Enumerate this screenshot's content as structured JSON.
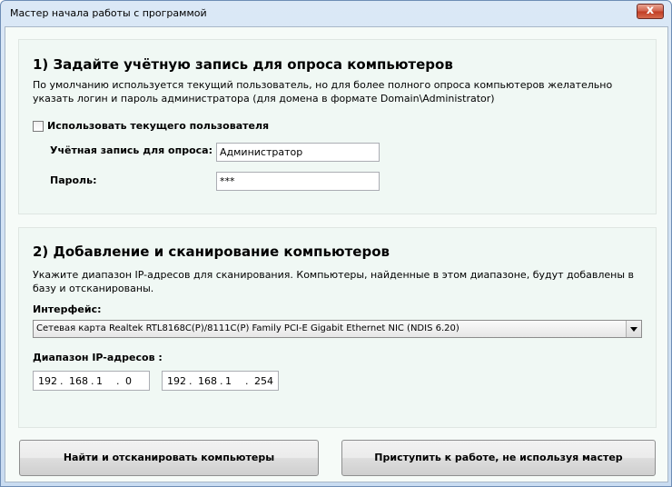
{
  "window": {
    "title": "Мастер начала работы с программой",
    "close_glyph": "x"
  },
  "section1": {
    "heading": "1) Задайте учётную запись для опроса компьютеров",
    "description": "По умолчанию используется текущий пользователь, но для более полного опроса компьютеров желательно указать логин и пароль администратора (для домена в формате Domain\\Administrator)",
    "use_current_user_label": "Использовать текущего пользователя",
    "use_current_user_checked": false,
    "account_label": "Учётная запись для опроса:",
    "account_value": "Администратор",
    "password_label": "Пароль:",
    "password_value": "***"
  },
  "section2": {
    "heading": "2) Добавление и сканирование компьютеров",
    "description": "Укажите диапазон IP-адресов для сканирования. Компьютеры, найденные в этом диапазоне, будут добавлены в базу и отсканированы.",
    "interface_label": "Интерфейс:",
    "interface_value": "Сетевая карта Realtek RTL8168C(P)/8111C(P) Family PCI-E Gigabit Ethernet NIC (NDIS 6.20)",
    "range_label": "Диапазон IP-адресов :",
    "ip_from": [
      "192",
      "168",
      "1",
      "0"
    ],
    "ip_to": [
      "192",
      "168",
      "1",
      "254"
    ],
    "ip_separator": "."
  },
  "buttons": {
    "scan": "Найти и отсканировать компьютеры",
    "skip": "Приступить к работе, не используя мастер"
  }
}
